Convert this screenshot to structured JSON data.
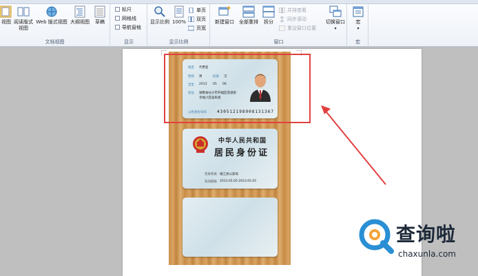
{
  "ribbon": {
    "views_group": {
      "label": "文档视图",
      "buttons": [
        "视图",
        "阅读版式\n视图",
        "Web 版式视图",
        "大纲视图",
        "草稿"
      ]
    },
    "show_group": {
      "label": "显示",
      "items": [
        {
          "label": "标尺",
          "checked": false
        },
        {
          "label": "网格线",
          "checked": false
        },
        {
          "label": "导航窗格",
          "checked": false
        }
      ]
    },
    "zoom_group": {
      "label": "显示比例",
      "zoom_label": "显示比例",
      "percent_label": "100%",
      "one_page": "单页",
      "two_pages": "双页",
      "page_width": "页宽"
    },
    "window_group": {
      "label": "窗口",
      "new_window": "新建窗口",
      "arrange_all": "全部重排",
      "split": "拆分",
      "side_by_side": "并排查看",
      "sync_scroll": "同步滚动",
      "reset_position": "重设窗口位置",
      "switch_windows": "切换窗口"
    },
    "macros_group": {
      "label": "宏",
      "macros": "宏"
    }
  },
  "id_front": {
    "name_label": "姓名",
    "name_value": "代用名",
    "sex_label": "性别",
    "sex_value": "男",
    "ethnic_label": "民族",
    "ethnic_value": "汉",
    "birth_label": "出生",
    "birth_year": "2013",
    "birth_month": "05",
    "birth_day": "06",
    "addr_label": "住址",
    "addr_line1": "湖南省长沙市开福区巡道街",
    "addr_line2": "幸福小区居民组",
    "number_label": "公民身份号码",
    "number_value": "430512198908131367"
  },
  "id_back": {
    "title_line1": "中华人民共和国",
    "title_line2": "居民身份证",
    "authority_label": "签发机关",
    "authority_value": "福江县公安局",
    "validity_label": "有效期限",
    "validity_value": "2013.05.05-2023.05.05"
  },
  "watermark": {
    "title": "查询啦",
    "url": "chaxunla.com"
  },
  "colors": {
    "highlight": "#e0403e",
    "arrow": "#e0403e",
    "watermark_accent": "#2a8fd4"
  }
}
